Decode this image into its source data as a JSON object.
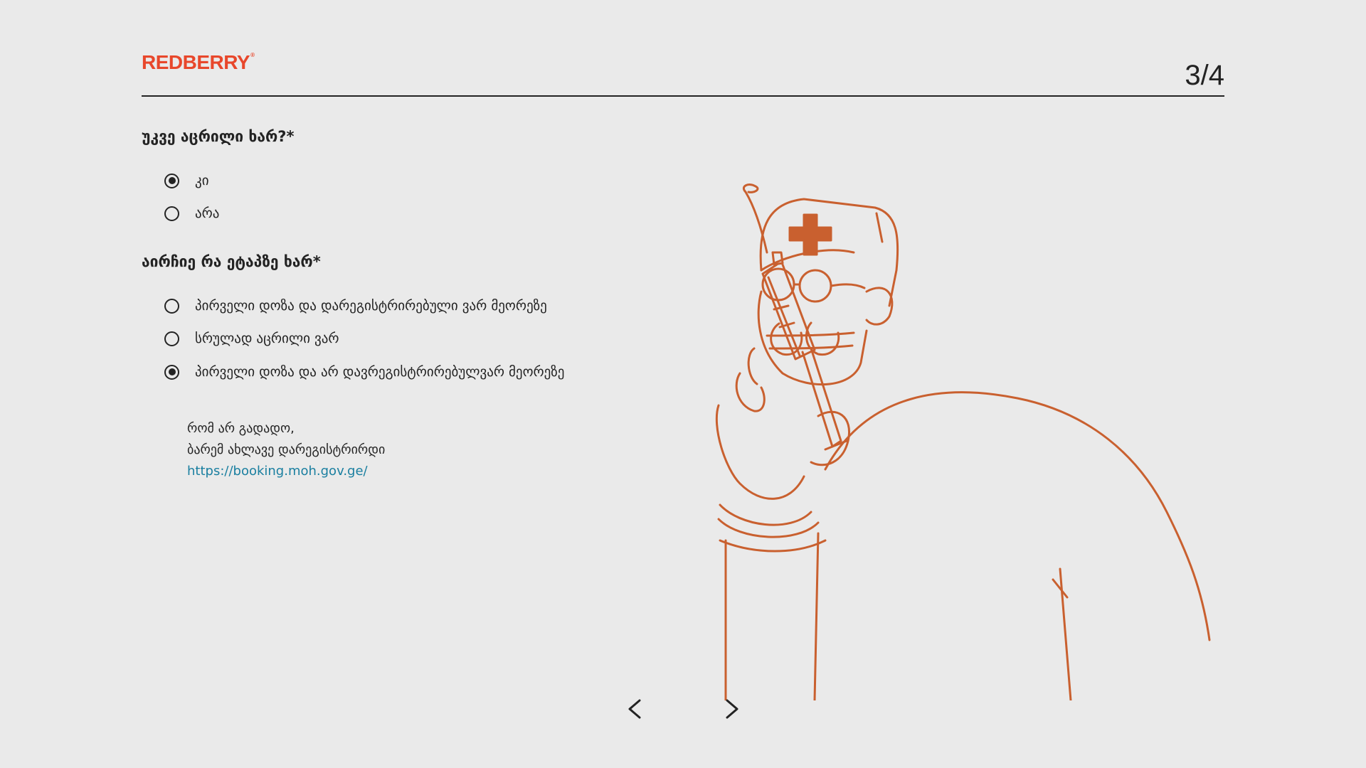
{
  "header": {
    "logo_text": "REDBERRY",
    "logo_mark": "®",
    "step_indicator": "3/4"
  },
  "questions": [
    {
      "label": "უკვე აცრილი ხარ?*",
      "options": [
        {
          "label": "კი",
          "selected": true
        },
        {
          "label": "არა",
          "selected": false
        }
      ]
    },
    {
      "label": "აირჩიე რა ეტაპზე ხარ*",
      "options": [
        {
          "label": "პირველი დოზა და დარეგისტრირებული ვარ მეორეზე",
          "selected": false
        },
        {
          "label": "სრულად აცრილი ვარ",
          "selected": false
        },
        {
          "label": "პირველი დოზა და არ დავრეგისტრირებულვარ მეორეზე",
          "selected": true
        }
      ]
    }
  ],
  "info": {
    "line1": "რომ არ გადადო,",
    "line2": "ბარემ ახლავე დარეგისტრირდი",
    "link": "https://booking.moh.gov.ge/"
  },
  "navigation": {
    "prev_icon": "chevron-left-icon",
    "next_icon": "chevron-right-icon"
  },
  "colors": {
    "accent": "#e8472b",
    "illustration": "#c9602f",
    "link": "#1a7fa0",
    "background": "#eaeaea",
    "text": "#232323"
  }
}
